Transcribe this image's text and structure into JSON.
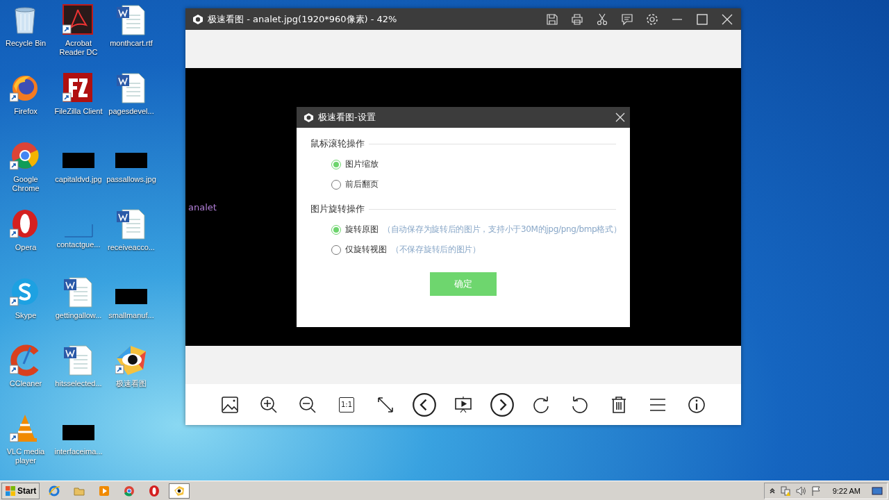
{
  "desktop_icons": [
    {
      "label": "Recycle Bin",
      "kind": "recycle",
      "shortcut": false
    },
    {
      "label": "Firefox",
      "kind": "firefox",
      "shortcut": true
    },
    {
      "label": "Google Chrome",
      "kind": "chrome",
      "shortcut": true
    },
    {
      "label": "Opera",
      "kind": "opera",
      "shortcut": true
    },
    {
      "label": "Skype",
      "kind": "skype",
      "shortcut": true
    },
    {
      "label": "CCleaner",
      "kind": "ccleaner",
      "shortcut": true
    },
    {
      "label": "VLC media player",
      "kind": "vlc",
      "shortcut": true
    },
    {
      "label": "Acrobat Reader DC",
      "kind": "acrobat",
      "shortcut": true
    },
    {
      "label": "FileZilla Client",
      "kind": "filezilla",
      "shortcut": true
    },
    {
      "label": "capitaldvd.jpg",
      "kind": "image"
    },
    {
      "label": "contactgue...",
      "kind": "blank"
    },
    {
      "label": "gettingallow...",
      "kind": "word",
      "shortcut": false
    },
    {
      "label": "hitsselected...",
      "kind": "word",
      "shortcut": false
    },
    {
      "label": "interfaceima...",
      "kind": "image"
    },
    {
      "label": "monthcart.rtf",
      "kind": "word",
      "shortcut": false
    },
    {
      "label": "pagesdevel...",
      "kind": "word",
      "shortcut": false
    },
    {
      "label": "passallows.jpg",
      "kind": "image"
    },
    {
      "label": "receiveacco...",
      "kind": "word",
      "shortcut": false
    },
    {
      "label": "smallmanuf...",
      "kind": "image"
    },
    {
      "label": "极速看图",
      "kind": "viewer",
      "shortcut": true
    }
  ],
  "window": {
    "title": "极速看图 - analet.jpg(1920*960像素) - 42%",
    "title_buttons": [
      {
        "kind": "save"
      },
      {
        "kind": "print"
      },
      {
        "kind": "cut"
      },
      {
        "kind": "feedback"
      },
      {
        "kind": "settings"
      },
      {
        "kind": "minimize"
      },
      {
        "kind": "maximize"
      },
      {
        "kind": "close"
      }
    ],
    "image_alt": "analet",
    "toolbar": [
      {
        "kind": "picture"
      },
      {
        "kind": "zoom-in"
      },
      {
        "kind": "zoom-out"
      },
      {
        "kind": "actual-size",
        "label": "1:1"
      },
      {
        "kind": "fullscreen"
      },
      {
        "kind": "prev"
      },
      {
        "kind": "slideshow"
      },
      {
        "kind": "next"
      },
      {
        "kind": "rotate-cw"
      },
      {
        "kind": "rotate-ccw"
      },
      {
        "kind": "delete"
      },
      {
        "kind": "menu"
      },
      {
        "kind": "info"
      }
    ]
  },
  "dialog": {
    "title": "极速看图-设置",
    "sections": [
      {
        "legend": "鼠标滚轮操作",
        "options": [
          {
            "label": "图片缩放",
            "selected": true
          },
          {
            "label": "前后翻页",
            "selected": false
          }
        ]
      },
      {
        "legend": "图片旋转操作",
        "options": [
          {
            "label": "旋转原图",
            "note": "（自动保存为旋转后的图片，支持小于30M的jpg/png/bmp格式）",
            "selected": true
          },
          {
            "label": "仅旋转视图",
            "note": "（不保存旋转后的图片）",
            "selected": false
          }
        ]
      }
    ],
    "ok_button": "确定"
  },
  "taskbar": {
    "start": "Start",
    "apps": [
      {
        "kind": "ie",
        "selected": false
      },
      {
        "kind": "explorer",
        "selected": false
      },
      {
        "kind": "media",
        "selected": false
      },
      {
        "kind": "chrome",
        "selected": false
      },
      {
        "kind": "opera",
        "selected": false
      },
      {
        "kind": "viewer",
        "selected": true
      }
    ],
    "clock": "9:22 AM"
  }
}
